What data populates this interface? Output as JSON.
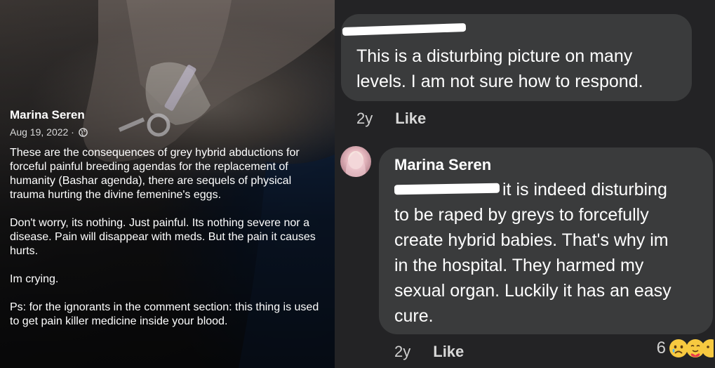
{
  "post": {
    "author": "Marina Seren",
    "date": "Aug 19, 2022 ·",
    "privacy_icon": "globe-icon",
    "paragraphs": [
      "These are the consequences of grey hybrid abductions for forceful painful breeding agendas for the replacement of humanity (Bashar agenda), there are sequels of physical trauma hurting the divine femenine's eggs.",
      "Don't worry, its nothing. Just painful. Its nothing severe nor a disease. Pain will disappear with meds. But the pain it causes hurts.",
      "Im crying.",
      "Ps: for the ignorants in the comment section: this thing is used to get pain killer medicine inside your blood."
    ]
  },
  "comments": [
    {
      "author": "",
      "text_line1": "This is a disturbing picture on many",
      "text_line2": "levels.  I am not sure how to respond.",
      "age": "2y",
      "like": "Like"
    },
    {
      "author": "Marina Seren",
      "text_first": "it is indeed disturbing",
      "lines": [
        "to be raped by greys to forcefully",
        "create hybrid babies. That's why im",
        "in the hospital. They harmed my",
        "sexual organ. Luckily it has an easy",
        "cure."
      ],
      "age": "2y",
      "like": "Like",
      "reaction_count": "6",
      "reaction_icons": [
        "sad-face-icon",
        "care-face-icon",
        "extra-reaction-icon"
      ]
    }
  ],
  "colors": {
    "bubble": "#3a3b3c",
    "panel": "#232325",
    "redaction": "#ffffff"
  }
}
